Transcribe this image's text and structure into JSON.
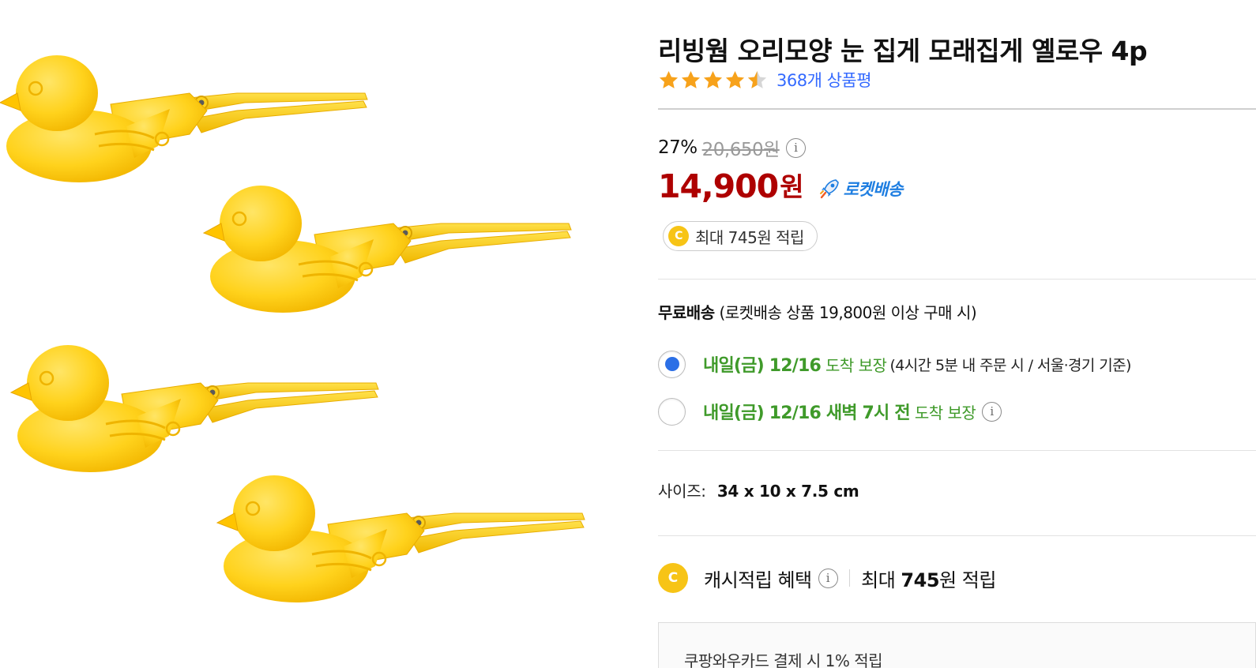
{
  "product": {
    "title": "리빙웜 오리모양 눈 집게 모래집게 옐로우 4p",
    "rating": 4.5,
    "rating_max": 5,
    "review_count_text": "368개 상품평",
    "image_icon": "duck-snowball-maker-icon"
  },
  "price": {
    "discount_rate": "27%",
    "original_price": "20,650원",
    "sale_price": "14,900",
    "sale_unit": "원",
    "delivery_badge": "로켓배송",
    "cash_pill": "최대 745원 적립",
    "coin_glyph": "C"
  },
  "shipping": {
    "free_label": "무료배송",
    "free_condition": "(로켓배송 상품 19,800원 이상 구매 시)",
    "options": [
      {
        "selected": true,
        "arrival": "내일(금) 12/16",
        "guarantee": "도착 보장",
        "note": "(4시간 5분 내 주문 시 / 서울·경기 기준)"
      },
      {
        "selected": false,
        "arrival": "내일(금) 12/16 새벽 7시 전",
        "guarantee": "도착 보장",
        "note": ""
      }
    ]
  },
  "size": {
    "label": "사이즈:",
    "value": "34 x 10 x 7.5 cm"
  },
  "cash_benefit": {
    "label": "캐시적립 혜택",
    "prefix": "최대",
    "amount": "745",
    "suffix": "원 적립"
  },
  "coupon": {
    "text": "쿠팡와우카드 결제 시 1% 적립"
  },
  "colors": {
    "sale_red": "#ae0000",
    "link_blue": "#346aff",
    "rocket_blue": "#1e7ee1",
    "arrival_green": "#3f9a2a",
    "star_orange": "#f7a21b",
    "coin_yellow": "#f7c416",
    "duck_yellow": "#ffd21c",
    "radio_blue": "#2b6fe6"
  }
}
